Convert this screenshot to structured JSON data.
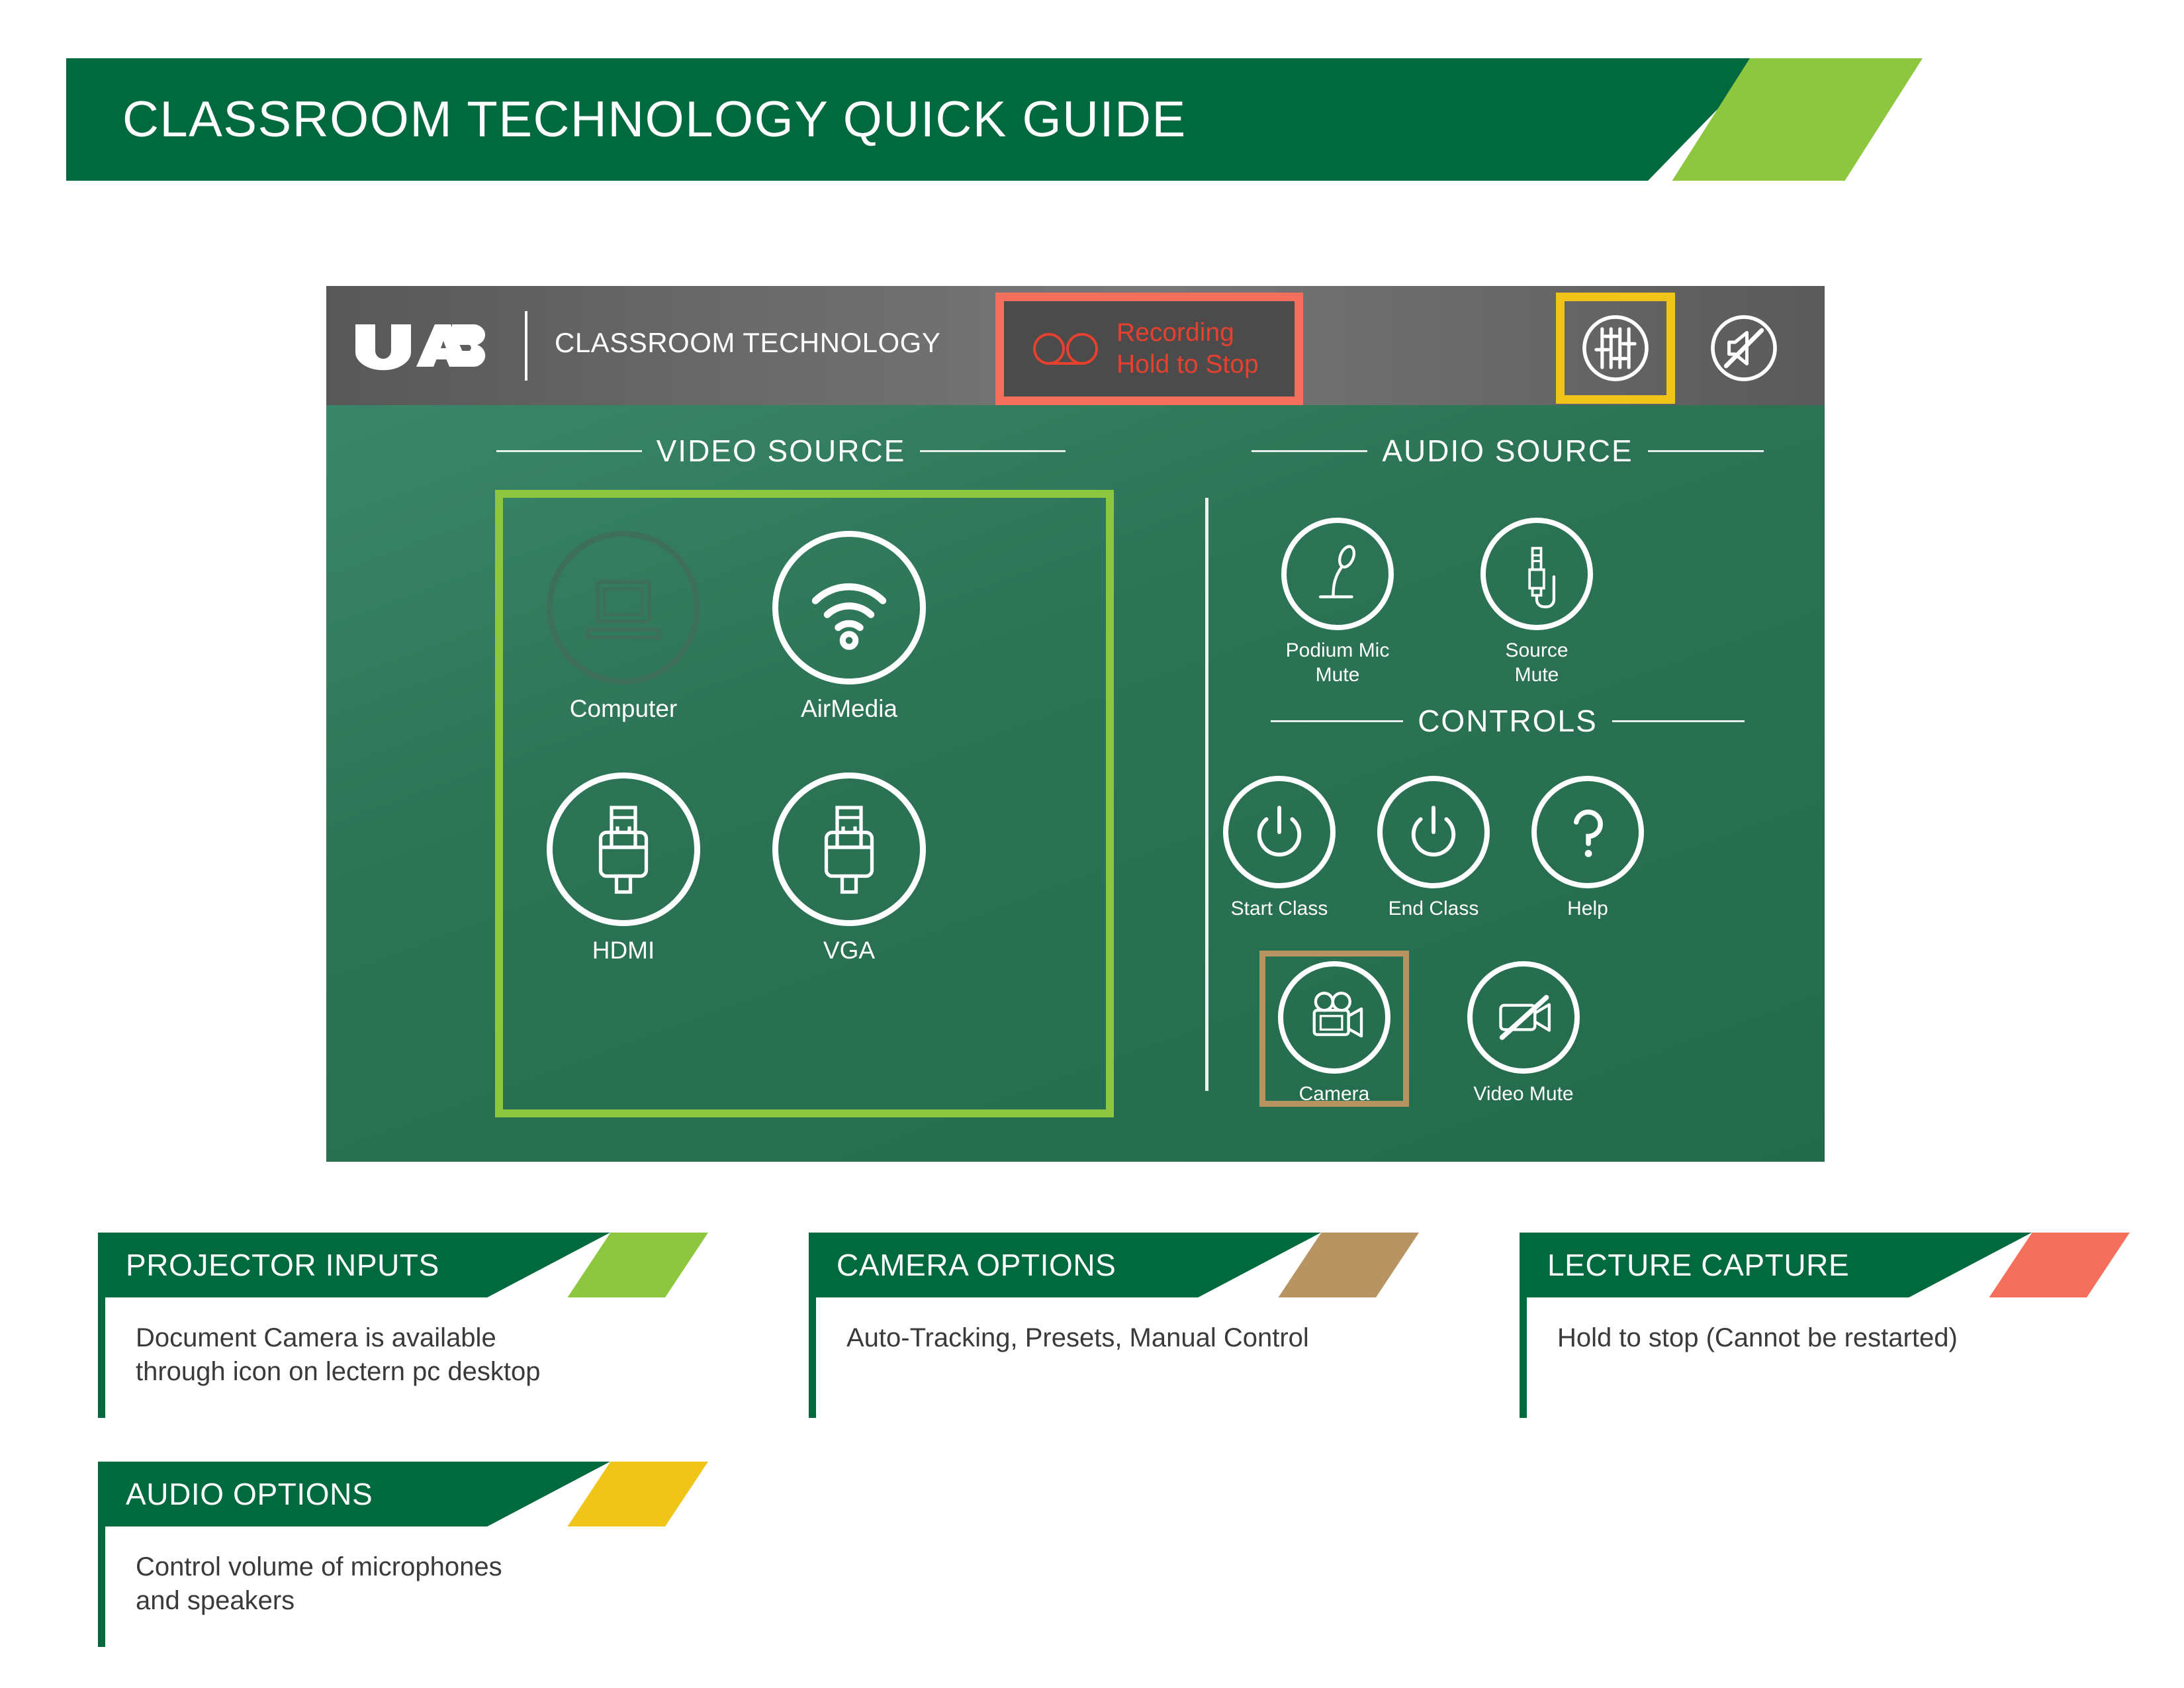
{
  "banner": {
    "title": "CLASSROOM TECHNOLOGY QUICK GUIDE"
  },
  "panel": {
    "brand": "UAB",
    "subtitle": "CLASSROOM TECHNOLOGY",
    "recording": {
      "line1": "Recording",
      "line2": "Hold to Stop",
      "icon": "cassette-tape-icon"
    },
    "header_icons": [
      {
        "name": "equalizer-icon",
        "highlight": "#f0c419"
      },
      {
        "name": "speaker-mute-icon",
        "highlight": "none"
      }
    ],
    "sections": {
      "video_source": {
        "title": "VIDEO SOURCE"
      },
      "audio_source": {
        "title": "AUDIO SOURCE"
      },
      "controls": {
        "title": "CONTROLS"
      }
    },
    "video_sources": [
      {
        "label": "Computer",
        "icon": "laptop-icon",
        "state": "dimmed"
      },
      {
        "label": "AirMedia",
        "icon": "wifi-icon",
        "state": "active"
      },
      {
        "label": "HDMI",
        "icon": "hdmi-plug-icon",
        "state": "active"
      },
      {
        "label": "VGA",
        "icon": "vga-plug-icon",
        "state": "active"
      }
    ],
    "audio_sources": [
      {
        "label": "Podium Mic\nMute",
        "label_line1": "Podium Mic",
        "label_line2": "Mute",
        "icon": "podium-microphone-icon"
      },
      {
        "label": "Source Mute",
        "label_line1": "Source",
        "label_line2": "Mute",
        "icon": "audio-jack-icon"
      }
    ],
    "controls": [
      {
        "label": "Start Class",
        "icon": "power-icon"
      },
      {
        "label": "End Class",
        "icon": "power-icon"
      },
      {
        "label": "Help",
        "icon": "question-mark-icon"
      },
      {
        "label": "Camera",
        "icon": "video-camera-icon"
      },
      {
        "label": "Video Mute",
        "icon": "video-camera-slash-icon"
      }
    ]
  },
  "cards": [
    {
      "title": "PROJECTOR INPUTS",
      "accent": "#8dc63f",
      "body_line1": "Document Camera is available",
      "body_line2": "through icon on lectern pc desktop"
    },
    {
      "title": "CAMERA OPTIONS",
      "accent": "#b79461",
      "body_line1": "Auto-Tracking, Presets, Manual Control",
      "body_line2": ""
    },
    {
      "title": "LECTURE CAPTURE",
      "accent": "#f4705c",
      "body_line1": "Hold to stop (Cannot be restarted)",
      "body_line2": ""
    },
    {
      "title": "AUDIO OPTIONS",
      "accent": "#f0c419",
      "body_line1": "Control volume of microphones",
      "body_line2": "and speakers"
    }
  ],
  "colors": {
    "brand_green": "#00693e",
    "accent_green": "#8dc63f",
    "panel_green": "#2c7355",
    "gold": "#b79461",
    "red": "#f4705c",
    "yellow": "#f0c419"
  }
}
